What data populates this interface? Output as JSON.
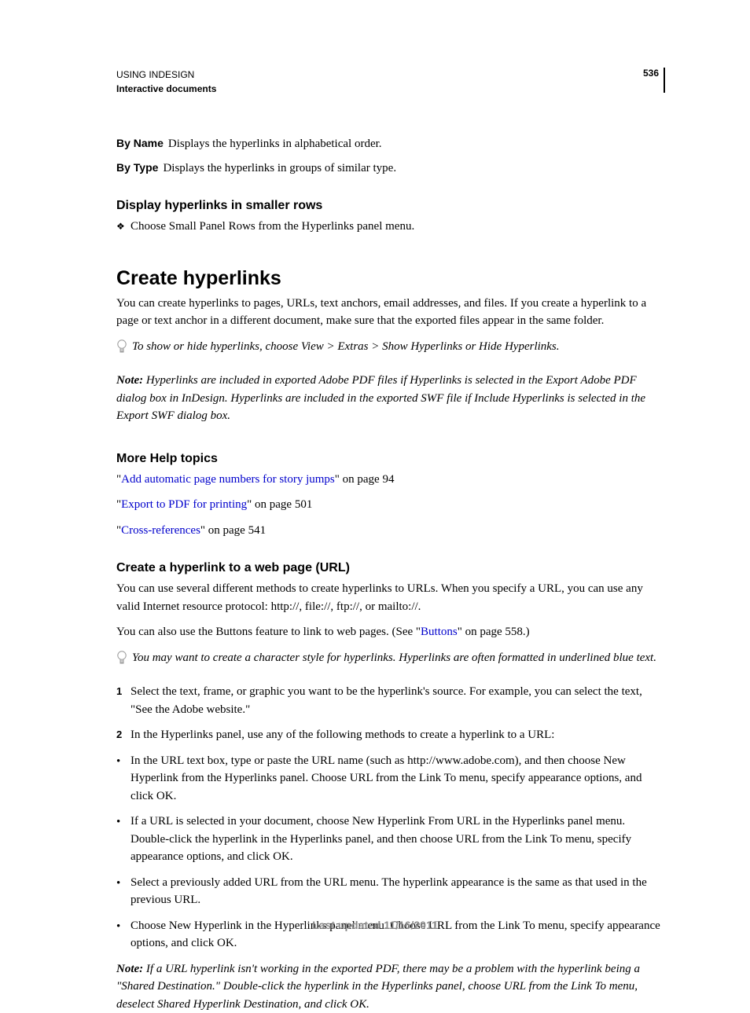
{
  "header": {
    "title": "USING INDESIGN",
    "section": "Interactive documents",
    "page_number": "536"
  },
  "defs": {
    "by_name_term": "By Name",
    "by_name_text": "Displays the hyperlinks in alphabetical order.",
    "by_type_term": "By Type",
    "by_type_text": "Displays the hyperlinks in groups of similar type."
  },
  "smaller_rows": {
    "heading": "Display hyperlinks in smaller rows",
    "bullet": "Choose Small Panel Rows from the Hyperlinks panel menu."
  },
  "create": {
    "heading": "Create hyperlinks",
    "intro": "You can create hyperlinks to pages, URLs, text anchors, email addresses, and files. If you create a hyperlink to a page or text anchor in a different document, make sure that the exported files appear in the same folder.",
    "tip": "To show or hide hyperlinks, choose View > Extras > Show Hyperlinks or Hide Hyperlinks.",
    "note_label": "Note:",
    "note_text": " Hyperlinks are included in exported Adobe PDF files if Hyperlinks is selected in the Export Adobe PDF dialog box in InDesign. Hyperlinks are included in the exported SWF file if Include Hyperlinks is selected in the Export SWF dialog box."
  },
  "more_help": {
    "heading": "More Help topics",
    "link1_text": "Add automatic page numbers for story jumps",
    "link1_suffix": "\" on page 94",
    "link2_text": "Export to PDF for printing",
    "link2_suffix": "\" on page 501",
    "link3_text": "Cross-references",
    "link3_suffix": "\" on page 541"
  },
  "url_section": {
    "heading": "Create a hyperlink to a web page (URL)",
    "p1": "You can use several different methods to create hyperlinks to URLs. When you specify a URL, you can use any valid Internet resource protocol: http://, file://, ftp://, or mailto://.",
    "p2_pre": "You can also use the Buttons feature to link to web pages. (See \"",
    "p2_link": "Buttons",
    "p2_post": "\" on page 558.)",
    "tip": "You may want to create a character style for hyperlinks. Hyperlinks are often formatted in underlined blue text.",
    "step1": "Select the text, frame, or graphic you want to be the hyperlink's source. For example, you can select the text, \"See the Adobe website.\"",
    "step2": "In the Hyperlinks panel, use any of the following methods to create a hyperlink to a URL:",
    "b1": "In the URL text box, type or paste the URL name (such as http://www.adobe.com), and then choose New Hyperlink from the Hyperlinks panel. Choose URL from the Link To menu, specify appearance options, and click OK.",
    "b2": "If a URL is selected in your document, choose New Hyperlink From URL in the Hyperlinks panel menu. Double-click the hyperlink in the Hyperlinks panel, and then choose URL from the Link To menu, specify appearance options, and click OK.",
    "b3": "Select a previously added URL from the URL menu. The hyperlink appearance is the same as that used in the previous URL.",
    "b4": "Choose New Hyperlink in the Hyperlinks panel menu. Choose URL from the Link To menu, specify appearance options, and click OK.",
    "note_label": "Note:",
    "note_text": " If a URL hyperlink isn't working in the exported PDF, there may be a problem with the hyperlink being a \"Shared Destination.\" Double-click the hyperlink in the Hyperlinks panel, choose URL from the Link To menu, deselect Shared Hyperlink Destination, and click OK."
  },
  "footer": {
    "text": "Last updated 11/16/2011"
  }
}
